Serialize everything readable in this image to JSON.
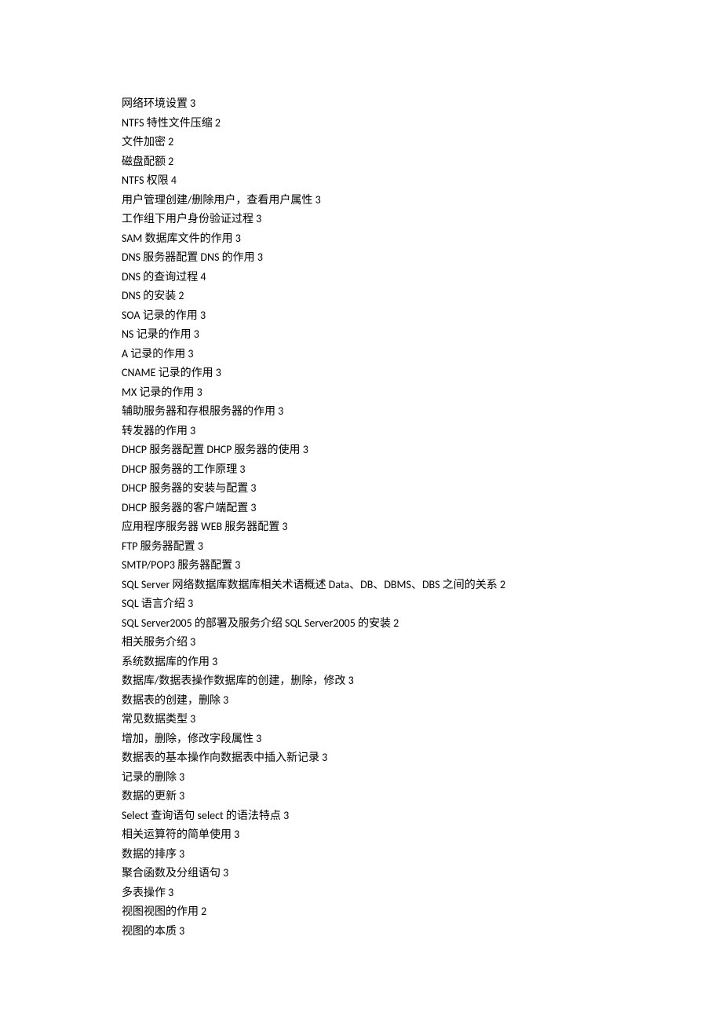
{
  "lines": [
    "网络环境设置 3",
    "NTFS 特性文件压缩 2",
    "文件加密 2",
    "磁盘配额 2",
    "NTFS 权限 4",
    "用户管理创建/删除用户，查看用户属性 3",
    "工作组下用户身份验证过程 3",
    "SAM 数据库文件的作用 3",
    "DNS 服务器配置  DNS 的作用 3",
    "DNS 的查询过程 4",
    "DNS 的安装 2",
    "SOA 记录的作用 3",
    "NS 记录的作用 3",
    "A 记录的作用 3",
    "CNAME 记录的作用 3",
    "MX 记录的作用 3",
    "辅助服务器和存根服务器的作用 3",
    "转发器的作用 3",
    "DHCP 服务器配置 DHCP 服务器的使用 3",
    "DHCP 服务器的工作原理 3",
    "DHCP 服务器的安装与配置 3",
    "DHCP 服务器的客户端配置 3",
    "应用程序服务器 WEB 服务器配置 3",
    "FTP 服务器配置 3",
    "SMTP/POP3 服务器配置 3",
    "SQL Server  网络数据库数据库相关术语概述 Data、DB、DBMS、DBS 之间的关系 2",
    "SQL 语言介绍 3",
    "SQL Server2005 的部署及服务介绍 SQL Server2005 的安装 2",
    "相关服务介绍 3",
    "系统数据库的作用 3",
    "数据库/数据表操作数据库的创建，删除，修改 3",
    "数据表的创建，删除 3",
    "常见数据类型 3",
    "增加，删除，修改字段属性 3",
    "数据表的基本操作向数据表中插入新记录 3",
    "记录的删除 3",
    "数据的更新 3",
    "Select  查询语句 select  的语法特点 3",
    "相关运算符的简单使用 3",
    "数据的排序 3",
    "聚合函数及分组语句 3",
    "多表操作 3",
    "视图视图的作用 2",
    "视图的本质 3"
  ]
}
